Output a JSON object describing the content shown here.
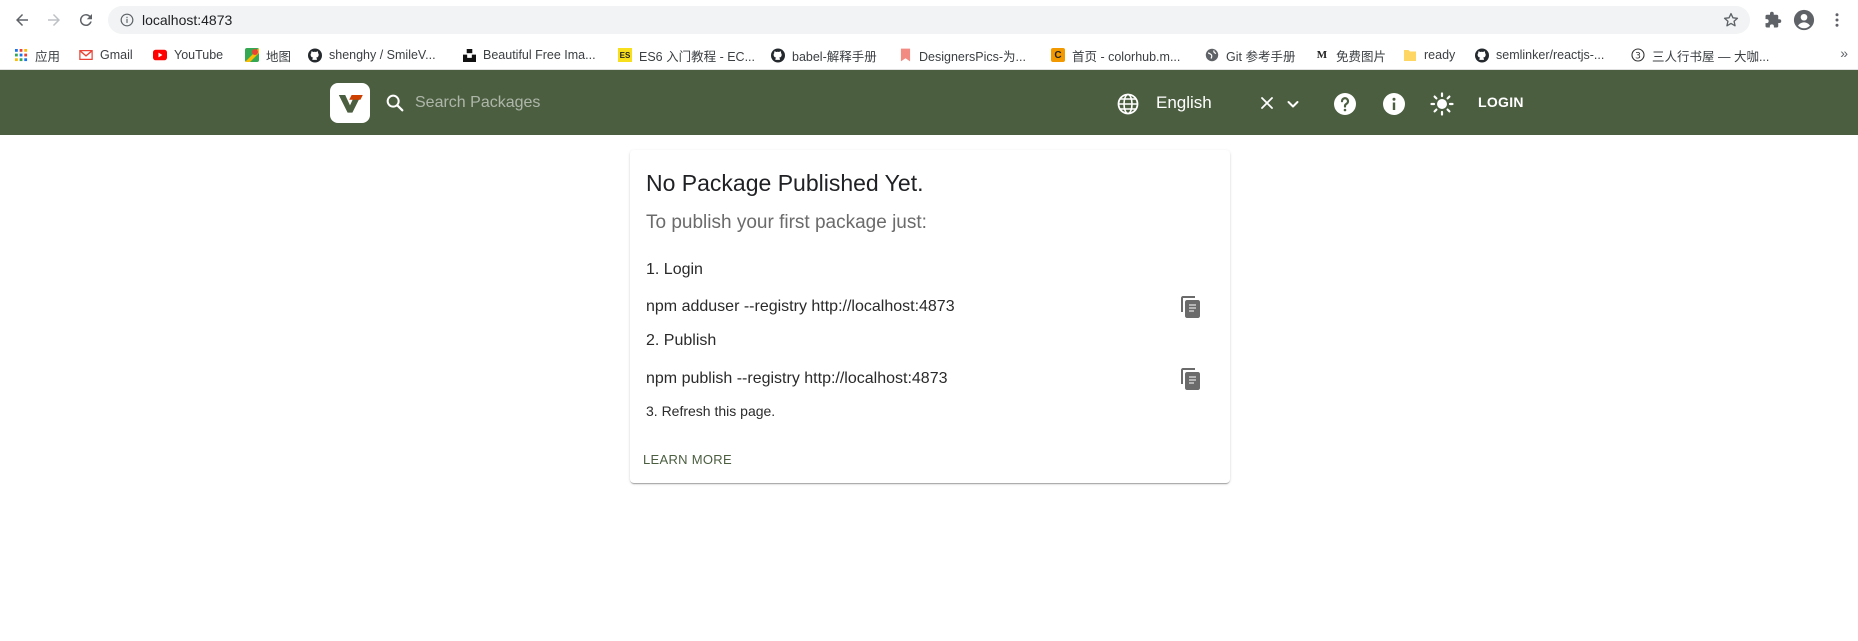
{
  "browser": {
    "url": "localhost:4873",
    "bookmarks": [
      {
        "label": "应用",
        "icon": "apps-grid-icon"
      },
      {
        "label": "Gmail",
        "icon": "gmail-icon"
      },
      {
        "label": "YouTube",
        "icon": "youtube-icon"
      },
      {
        "label": "地图",
        "icon": "maps-icon"
      },
      {
        "label": "shenghy / SmileV...",
        "icon": "github-icon"
      },
      {
        "label": "Beautiful Free Ima...",
        "icon": "unsplash-icon"
      },
      {
        "label": "ES6 入门教程 - EC...",
        "icon": "es-icon"
      },
      {
        "label": "babel-解释手册",
        "icon": "github-icon"
      },
      {
        "label": "DesignersPics-为...",
        "icon": "bookmark-icon"
      },
      {
        "label": "首页 - colorhub.m...",
        "icon": "colorhub-icon"
      },
      {
        "label": "Git 参考手册",
        "icon": "globe-icon"
      },
      {
        "label": "免费图片",
        "icon": "m-icon"
      },
      {
        "label": "ready",
        "icon": "folder-icon"
      },
      {
        "label": "semlinker/reactjs-...",
        "icon": "github-icon"
      },
      {
        "label": "三人行书屋 — 大咖...",
        "icon": "circle-3-icon"
      }
    ],
    "bookmarks_more": "»"
  },
  "header": {
    "search_placeholder": "Search Packages",
    "language": "English",
    "login_label": "LOGIN",
    "brand_color": "#4b5e40"
  },
  "card": {
    "title": "No Package Published Yet.",
    "subtitle": "To publish your first package just:",
    "step1": "1. Login",
    "cmd1": "npm adduser --registry http://localhost:4873",
    "step2": "2. Publish",
    "cmd2": "npm publish --registry http://localhost:4873",
    "step3": "3. Refresh this page.",
    "learn_more": "LEARN MORE"
  }
}
